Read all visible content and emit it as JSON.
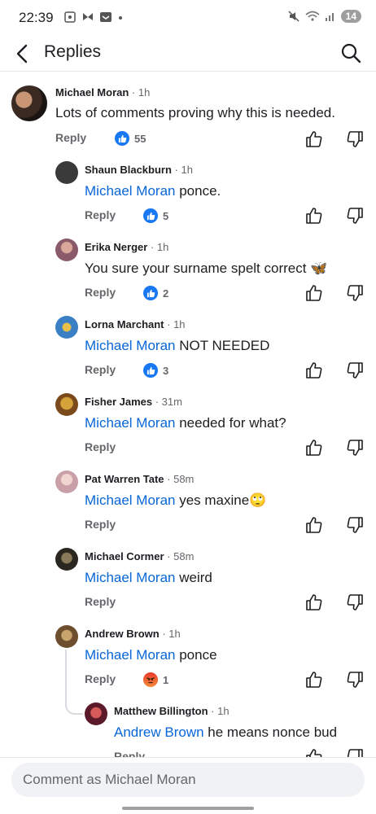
{
  "status_bar": {
    "time": "22:39",
    "battery": "14"
  },
  "header": {
    "title": "Replies"
  },
  "comments": [
    {
      "author": "Michael Moran",
      "time": "· 1h",
      "mention": "",
      "text": "Lots of comments proving why this is needed.",
      "reply": "Reply",
      "reaction_count": "55"
    },
    {
      "author": "Shaun Blackburn",
      "time": "· 1h",
      "mention": "Michael Moran",
      "text": " ponce.",
      "reply": "Reply",
      "reaction_count": "5"
    },
    {
      "author": "Erika Nerger",
      "time": "· 1h",
      "mention": "",
      "text": "You sure your surname spelt correct 🦋",
      "reply": "Reply",
      "reaction_count": "2"
    },
    {
      "author": "Lorna Marchant",
      "time": "· 1h",
      "mention": "Michael Moran",
      "text": " NOT NEEDED",
      "reply": "Reply",
      "reaction_count": "3"
    },
    {
      "author": "Fisher James",
      "time": "· 31m",
      "mention": "Michael Moran",
      "text": " needed for what?",
      "reply": "Reply",
      "reaction_count": ""
    },
    {
      "author": "Pat Warren Tate",
      "time": "· 58m",
      "mention": "Michael Moran",
      "text": " yes maxine🙄",
      "reply": "Reply",
      "reaction_count": ""
    },
    {
      "author": "Michael Cormer",
      "time": "· 58m",
      "mention": "Michael Moran",
      "text": " weird",
      "reply": "Reply",
      "reaction_count": ""
    },
    {
      "author": "Andrew Brown",
      "time": "· 1h",
      "mention": "Michael Moran",
      "text": " ponce",
      "reply": "Reply",
      "reaction_count": "1"
    },
    {
      "author": "Matthew Billington",
      "time": "· 1h",
      "mention": "Andrew Brown",
      "text": " he means nonce bud",
      "reply": "Reply",
      "reaction_count": ""
    }
  ],
  "composer": {
    "placeholder": "Comment as Michael Moran"
  },
  "colors": {
    "accent": "#0866d8",
    "like": "#1877f2",
    "angry": "#e93a2c"
  }
}
